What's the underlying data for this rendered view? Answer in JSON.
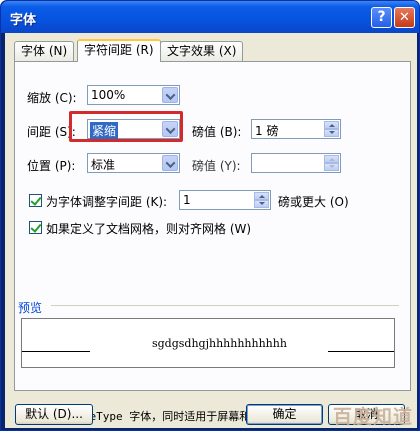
{
  "window": {
    "title": "字体",
    "help_label": "?",
    "close_label": "✕"
  },
  "tabs": [
    {
      "label": "字体 (N)",
      "active": false
    },
    {
      "label": "字符间距 (R)",
      "active": true
    },
    {
      "label": "文字效果 (X)",
      "active": false
    }
  ],
  "scale": {
    "label": "缩放 (C):",
    "value": "100%"
  },
  "spacing": {
    "label": "间距 (S):",
    "value": "紧缩",
    "by_label": "磅值 (B):",
    "by_value": "1 磅"
  },
  "position": {
    "label": "位置 (P):",
    "value": "标准",
    "by_label": "磅值 (Y):",
    "by_value": ""
  },
  "kerning": {
    "label": "为字体调整字间距 (K):",
    "value": "1",
    "suffix": "磅或更大 (O)",
    "checked": true
  },
  "grid": {
    "label": "如果定义了文档网格，则对齐网格 (W)",
    "checked": true
  },
  "preview": {
    "title": "预览",
    "sample": "sgdgsdhgjhhhhhhhhhhh"
  },
  "footnote": "这是一种 TrueType 字体，同时适用于屏幕和打印机。",
  "buttons": {
    "default": "默认 (D)...",
    "ok": "确定",
    "cancel": "取消"
  },
  "watermark": "百度知道",
  "colors": {
    "titlebar": "#0653e0",
    "face": "#ece9d8",
    "highlight": "#d22b2b",
    "preview_label": "#0046d5"
  }
}
